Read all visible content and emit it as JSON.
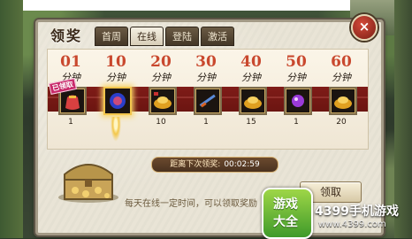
{
  "window": {
    "title": "领奖",
    "close_label": "×"
  },
  "tabs": [
    {
      "label": "首周",
      "active": false
    },
    {
      "label": "在线",
      "active": true
    },
    {
      "label": "登陆",
      "active": false
    },
    {
      "label": "激活",
      "active": false
    }
  ],
  "rewards": [
    {
      "number": "01",
      "unit": "分钟",
      "count": "1",
      "icon": "red-pouch-icon",
      "badge": "已领取"
    },
    {
      "number": "10",
      "unit": "分钟",
      "count": "1",
      "icon": "blue-orb-icon",
      "active": true
    },
    {
      "number": "20",
      "unit": "分钟",
      "count": "10",
      "icon": "gold-ingot-icon"
    },
    {
      "number": "30",
      "unit": "分钟",
      "count": "1",
      "icon": "sword-icon"
    },
    {
      "number": "40",
      "unit": "分钟",
      "count": "15",
      "icon": "gold-ingot-icon"
    },
    {
      "number": "50",
      "unit": "分钟",
      "count": "1",
      "icon": "purple-orb-icon"
    },
    {
      "number": "60",
      "unit": "分钟",
      "count": "20",
      "icon": "gold-ingot-icon"
    }
  ],
  "timer": {
    "label": "距离下次领奖:",
    "value": "00:02:59"
  },
  "claim_button": "领取",
  "hint": "每天在线一定时间，可以领取奖励",
  "watermark": {
    "line1": "游戏",
    "line2": "大全",
    "brand": "4399手机游戏",
    "url": "www.4399.com"
  },
  "colors": {
    "accent": "#c9482e",
    "panel": "#e9e4d6",
    "wall": "#7f1c18",
    "brand_green": "#3f9a2a"
  }
}
